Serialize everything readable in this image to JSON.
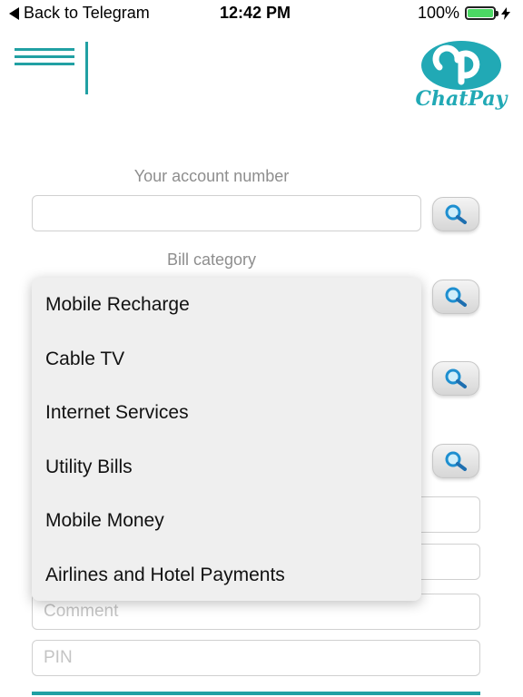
{
  "status_bar": {
    "back_label": "Back to Telegram",
    "time": "12:42 PM",
    "battery_percent_label": "100%",
    "battery_level": 1.0
  },
  "header": {
    "logo_text": "ChatPay"
  },
  "form": {
    "account_label": "Your account number",
    "account_value": "",
    "bill_category_label": "Bill category",
    "comment_placeholder": "Comment",
    "pin_placeholder": "PIN"
  },
  "dropdown": {
    "options": [
      "Mobile Recharge",
      "Cable TV",
      "Internet Services",
      "Utility Bills",
      "Mobile Money",
      "Airlines and Hotel Payments"
    ]
  },
  "colors": {
    "accent": "#21a0a3",
    "logo": "#21a9b5",
    "battery": "#4cd964"
  }
}
